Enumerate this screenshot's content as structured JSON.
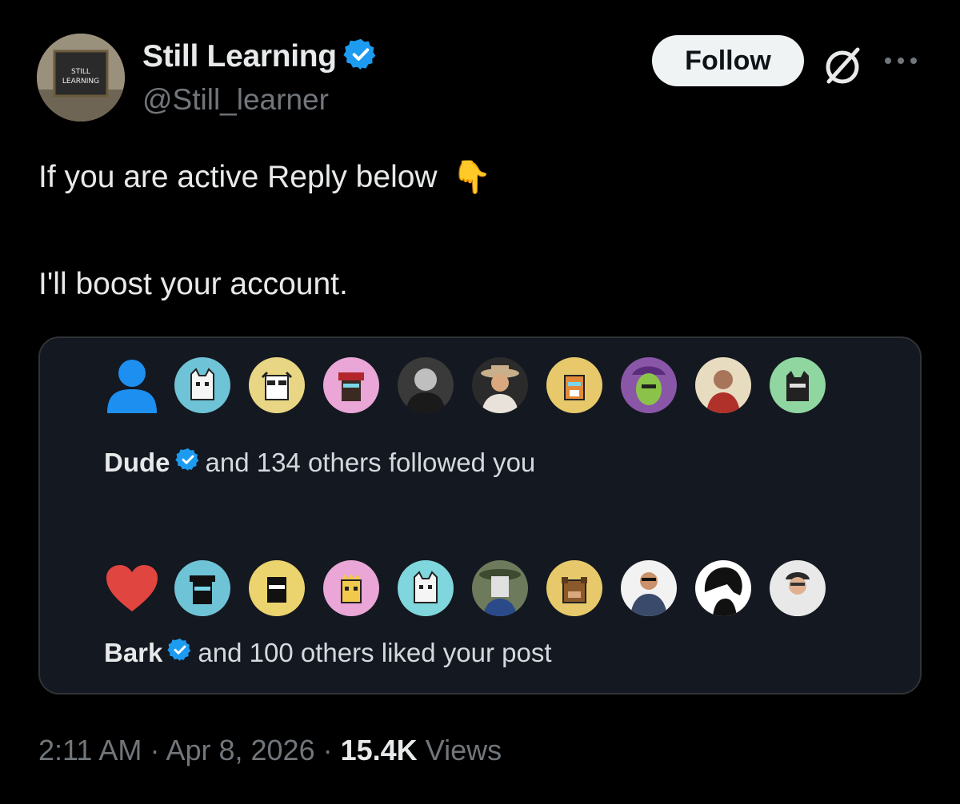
{
  "author": {
    "display_name": "Still Learning",
    "handle": "@Still_learner",
    "avatar_text_1": "STILL",
    "avatar_text_2": "LEARNING"
  },
  "header": {
    "follow_label": "Follow"
  },
  "post": {
    "line1": "If you are active Reply below",
    "line1_emoji": "👇",
    "line2": "I'll boost your account."
  },
  "card": {
    "follow_notification": {
      "name": "Dude",
      "text": "and 134 others followed you",
      "avatars": [
        "#6fc3d6",
        "#e8d684",
        "#e9a6d6",
        "#3a3a3a",
        "#2b2b2b",
        "#e7c96b",
        "#8a56a8",
        "#e8dcc0",
        "#8fd6a0"
      ]
    },
    "like_notification": {
      "name": "Bark",
      "text": "and 100 others liked your post",
      "avatars": [
        "#6fc3d6",
        "#ebd36e",
        "#e9a6d6",
        "#7fd6dc",
        "#6e7a5c",
        "#e7c96b",
        "#f2f2f2",
        "#ffffff",
        "#e9e9e9"
      ]
    }
  },
  "meta": {
    "time": "2:11 AM",
    "date": "Apr 8, 2026",
    "views_count": "15.4K",
    "views_label": "Views"
  },
  "colors": {
    "verified_blue": "#1d9bf0",
    "heart_red": "#e0453f",
    "person_blue": "#1d8ff0"
  }
}
